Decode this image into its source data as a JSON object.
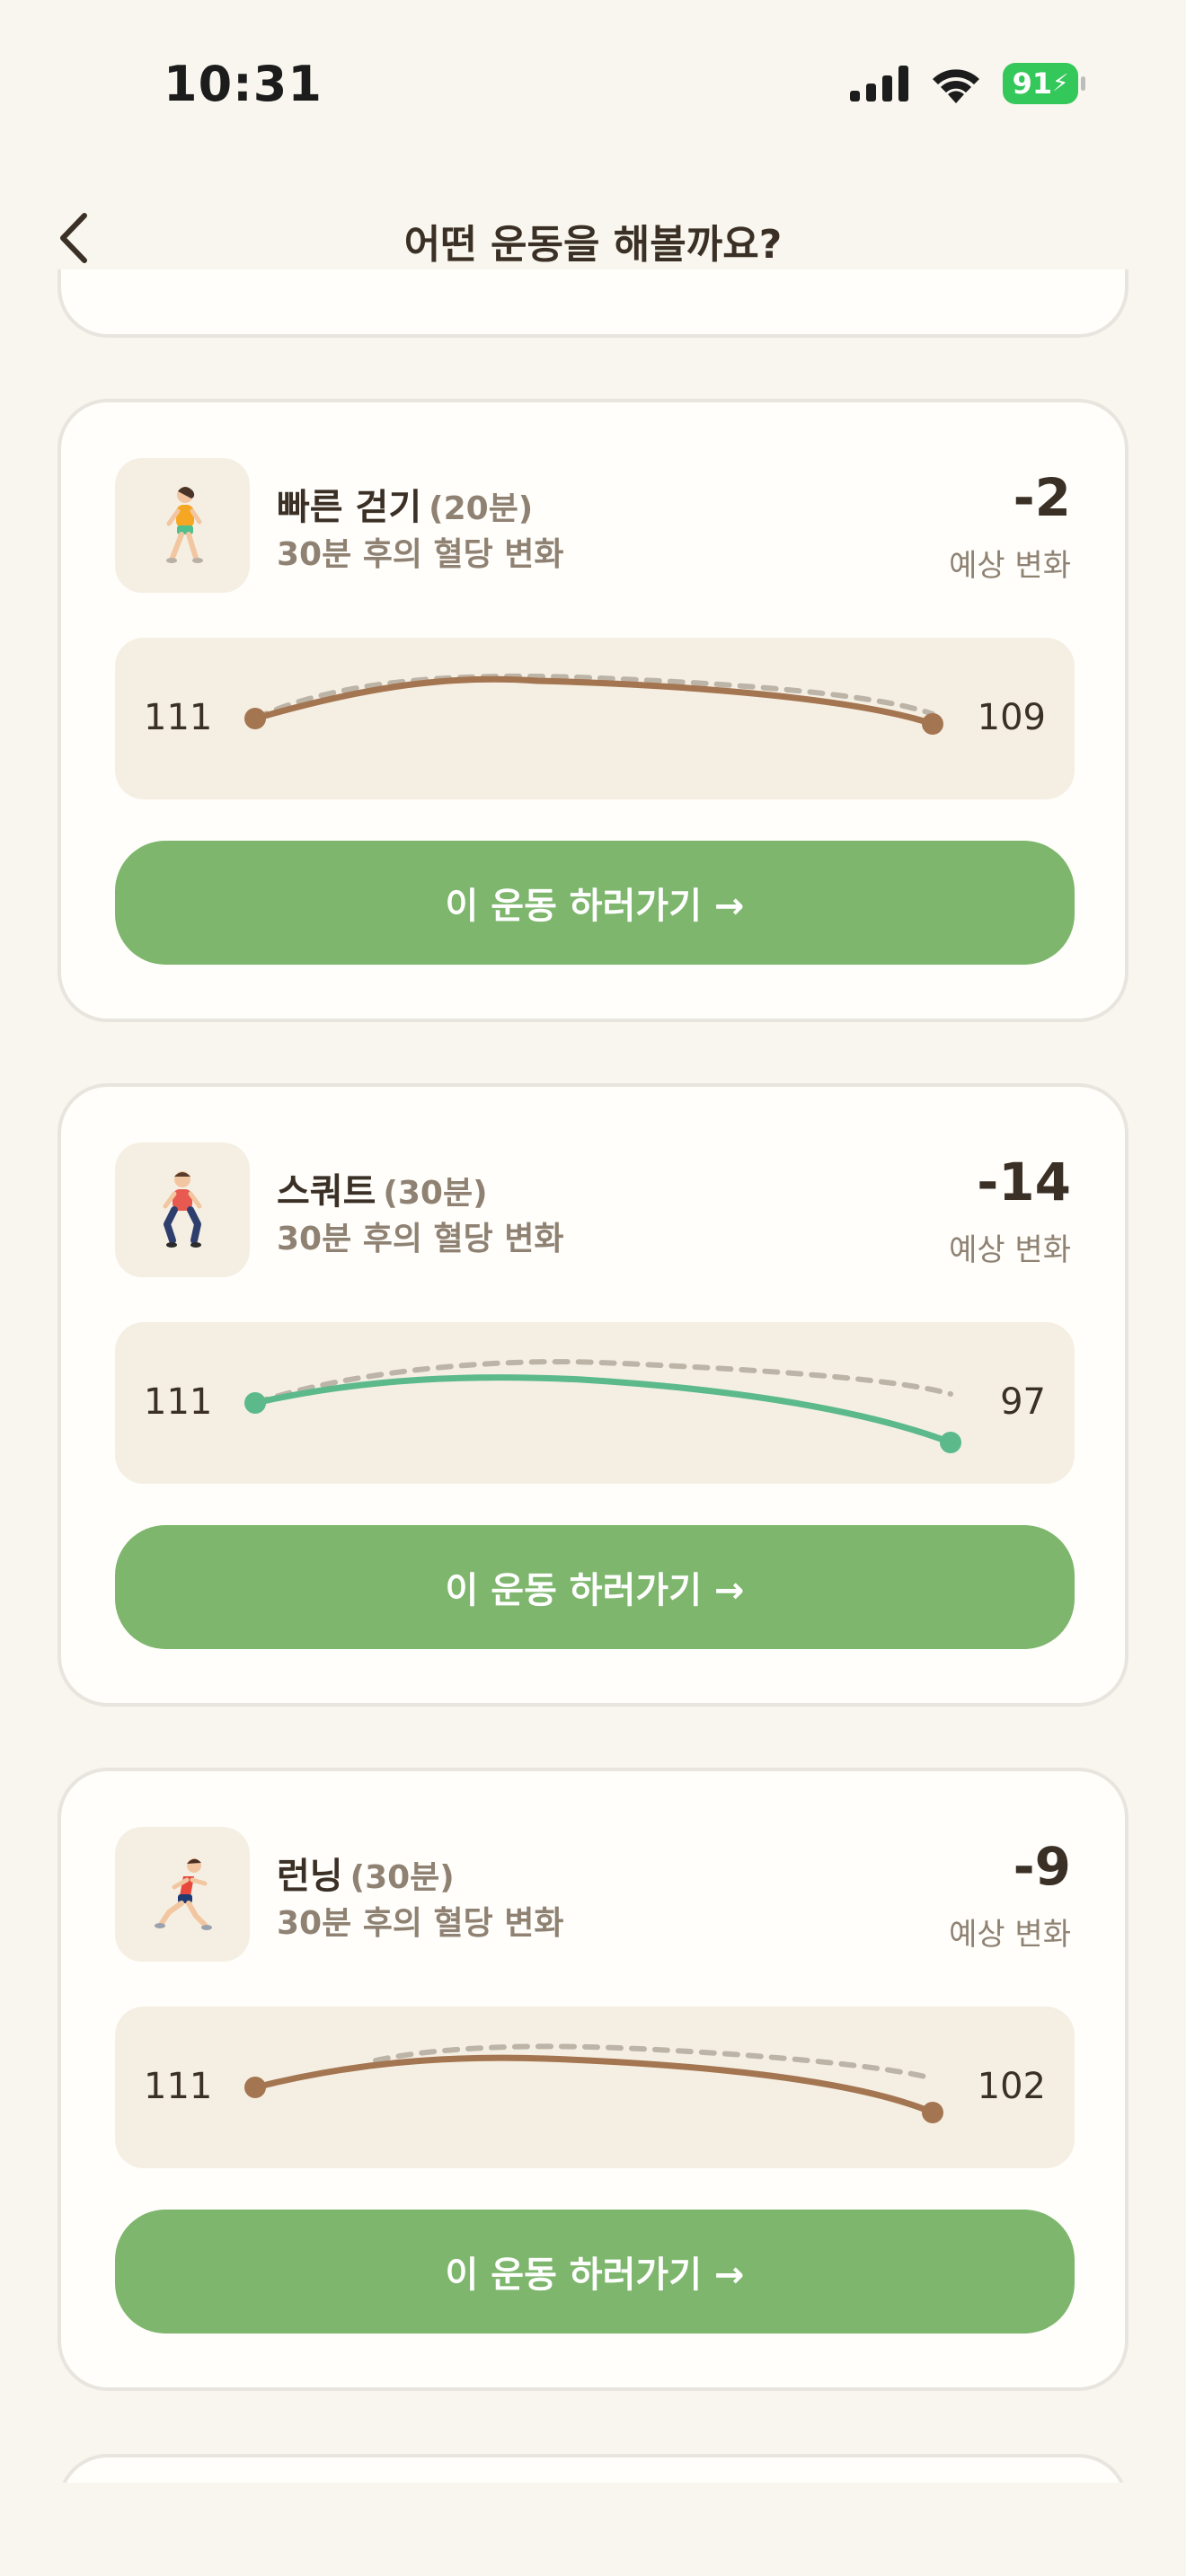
{
  "status": {
    "time": "10:31",
    "battery": "91"
  },
  "header": {
    "title": "어떤 운동을 해볼까요?"
  },
  "colors": {
    "brown_line": "#a47551",
    "green_line": "#5bb98a",
    "dashed": "#bdb4a8",
    "button": "#7db66c"
  },
  "exercises": [
    {
      "icon": "walking-person-icon",
      "name": "빠른 걷기",
      "duration": "(20분)",
      "subtitle": "30분 후의 혈당 변화",
      "delta": "-2",
      "delta_label": "예상 변화",
      "start_value": "111",
      "end_value": "109",
      "line_color": "#a47551",
      "button_label": "이 운동 하러가기 →"
    },
    {
      "icon": "squat-person-icon",
      "name": "스쿼트",
      "duration": "(30분)",
      "subtitle": "30분 후의 혈당 변화",
      "delta": "-14",
      "delta_label": "예상 변화",
      "start_value": "111",
      "end_value": "97",
      "line_color": "#5bb98a",
      "button_label": "이 운동 하러가기 →"
    },
    {
      "icon": "running-person-icon",
      "name": "런닝",
      "duration": "(30분)",
      "subtitle": "30분 후의 혈당 변화",
      "delta": "-9",
      "delta_label": "예상 변화",
      "start_value": "111",
      "end_value": "102",
      "line_color": "#a47551",
      "button_label": "이 운동 하러가기 →"
    }
  ]
}
